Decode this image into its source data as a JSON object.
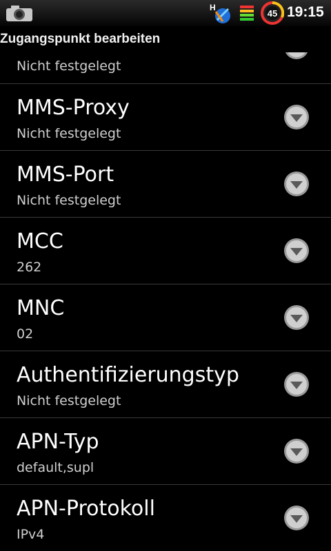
{
  "status_bar": {
    "time": "19:15",
    "battery_level": "45",
    "network_type": "H",
    "icons": [
      "camera-icon",
      "network-signal-icon",
      "battery-list-icon",
      "battery-icon"
    ]
  },
  "title_bar": {
    "title": "Zugangspunkt bearbeiten"
  },
  "list": {
    "partial_item": {
      "summary": "Nicht festgelegt"
    },
    "items": [
      {
        "label": "MMS-Proxy",
        "summary": "Nicht festgelegt"
      },
      {
        "label": "MMS-Port",
        "summary": "Nicht festgelegt"
      },
      {
        "label": "MCC",
        "summary": "262"
      },
      {
        "label": "MNC",
        "summary": "02"
      },
      {
        "label": "Authentifizierungstyp",
        "summary": "Nicht festgelegt"
      },
      {
        "label": "APN-Typ",
        "summary": "default,supl"
      },
      {
        "label": "APN-Protokoll",
        "summary": "IPv4"
      }
    ]
  },
  "colors": {
    "background": "#000000",
    "divider": "#3a3a3a",
    "primary_text": "#ffffff",
    "secondary_text": "#d0d0d0"
  }
}
